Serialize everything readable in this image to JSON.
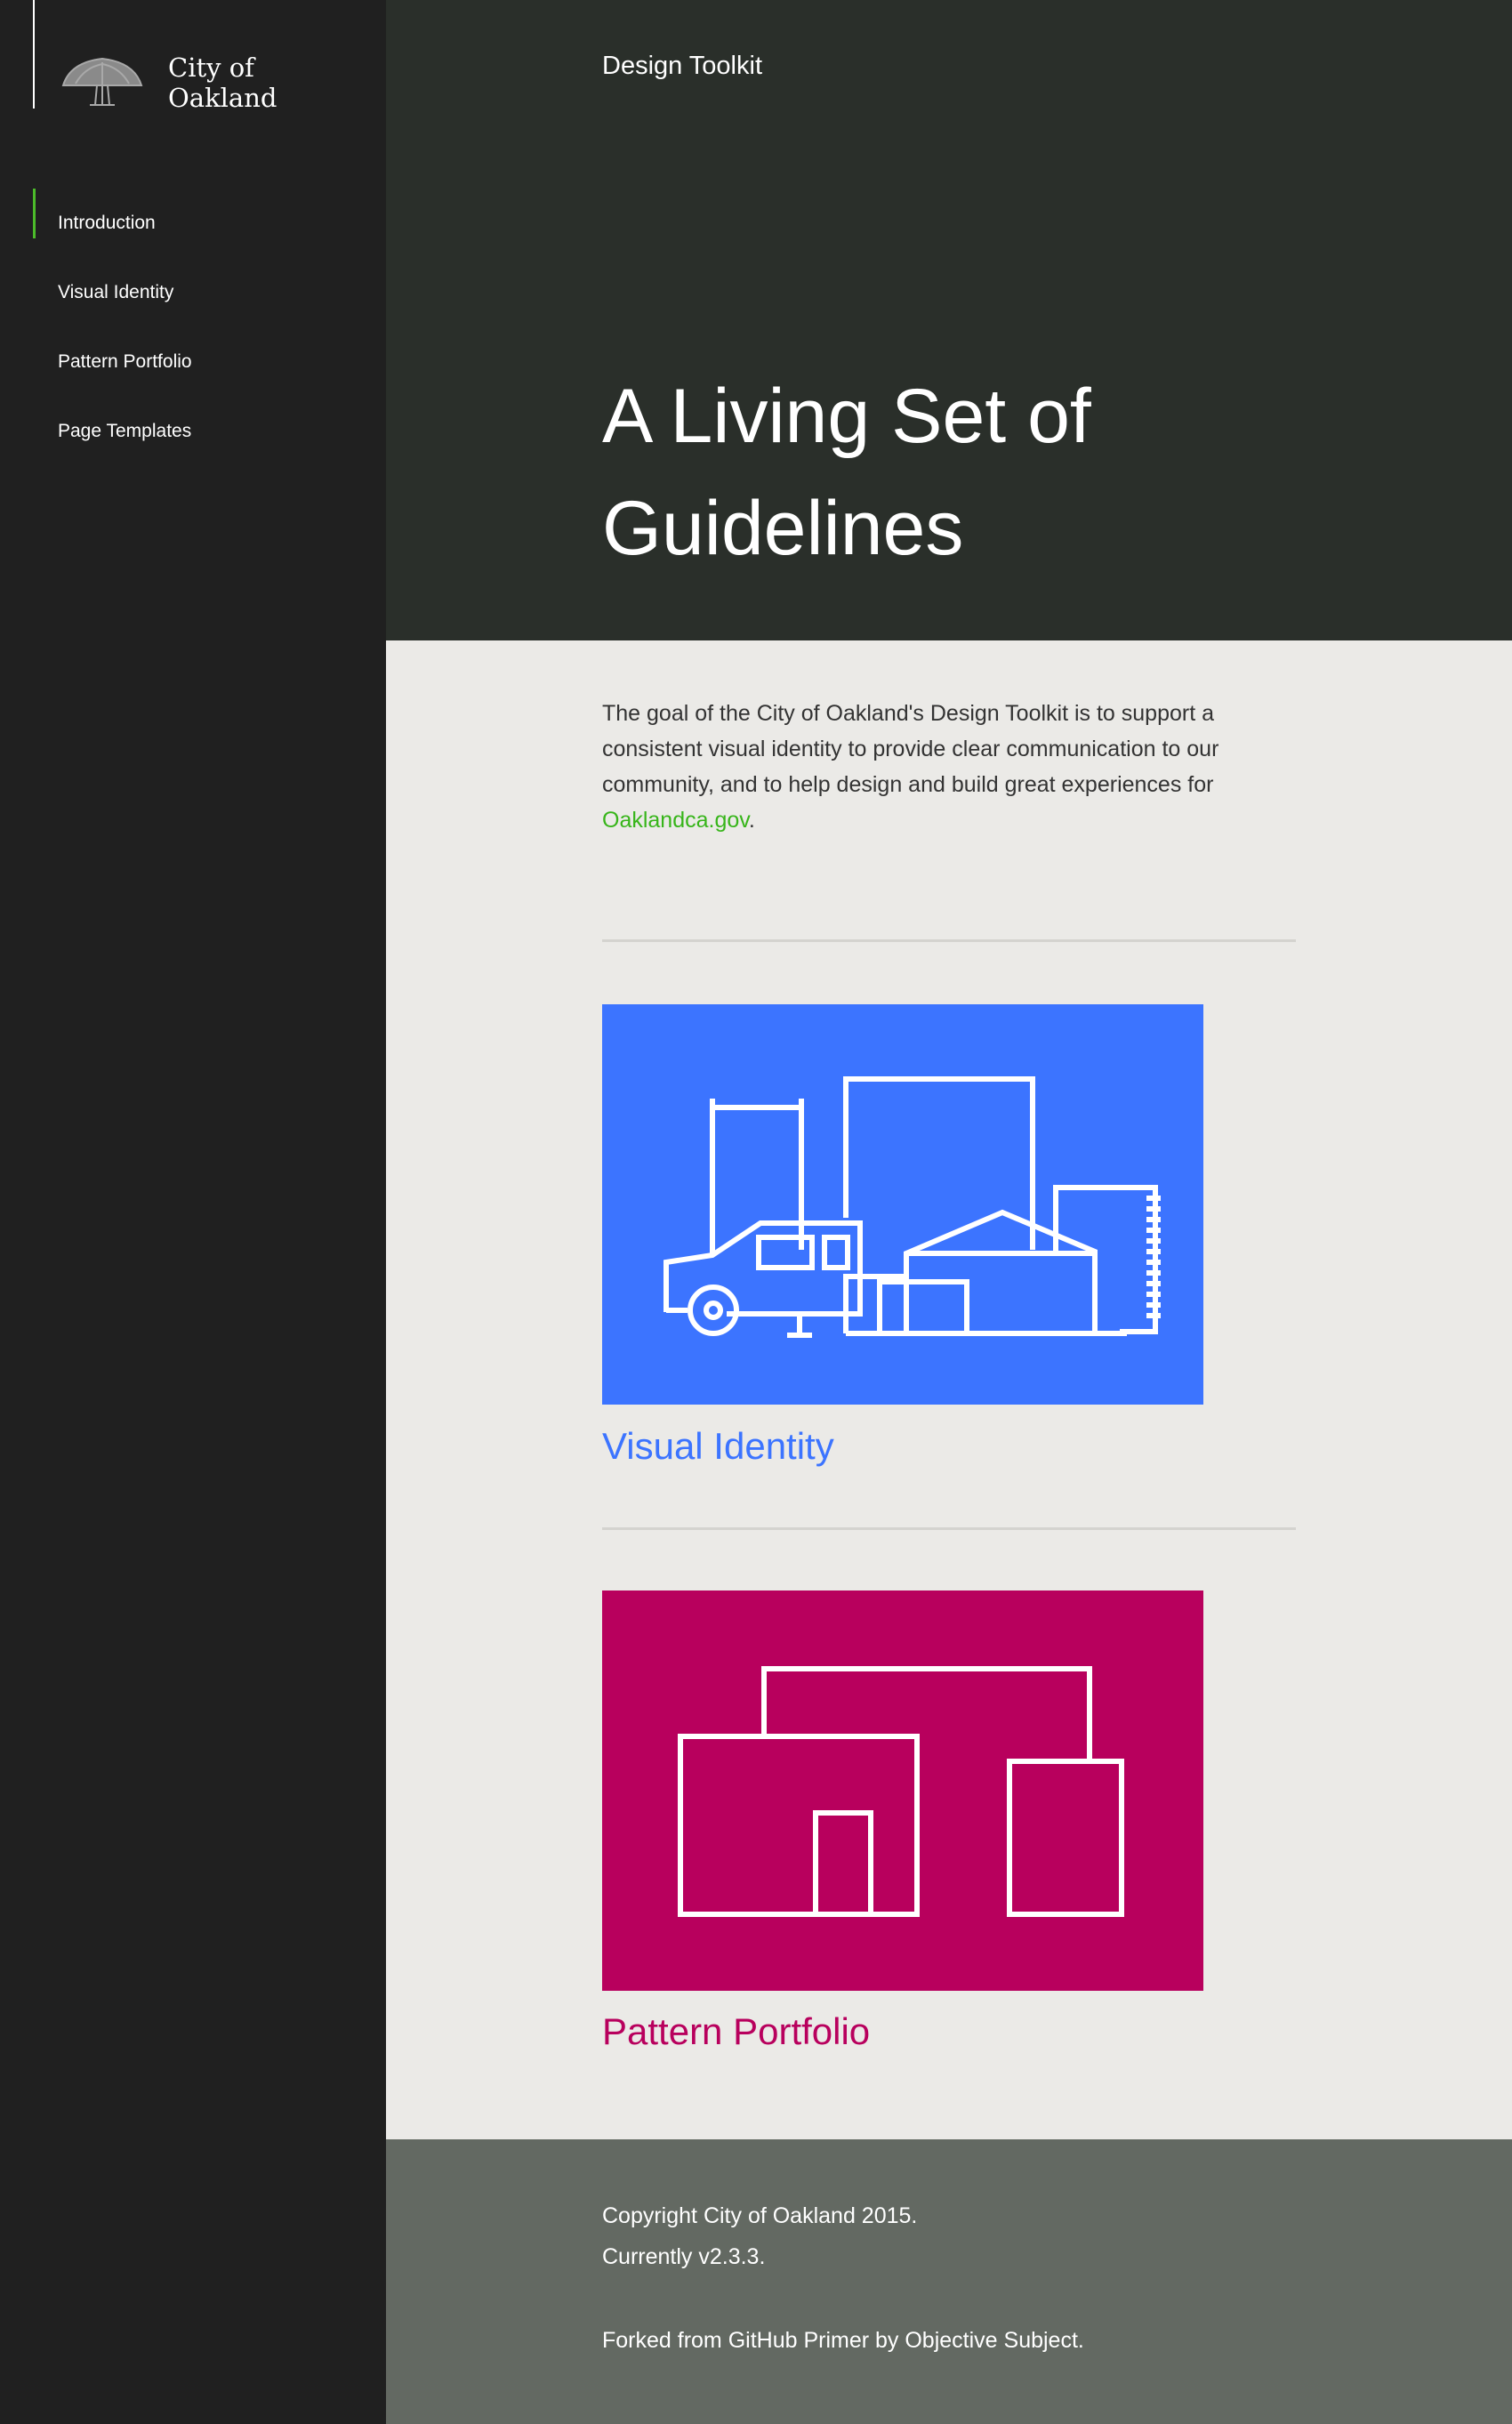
{
  "sidebar": {
    "logo": {
      "line1": "City of",
      "line2": "Oakland",
      "icon": "oak-tree-icon"
    },
    "nav": [
      {
        "label": "Introduction",
        "active": true
      },
      {
        "label": "Visual Identity"
      },
      {
        "label": "Pattern Portfolio"
      },
      {
        "label": "Page Templates"
      }
    ]
  },
  "header": {
    "brand": "Design Toolkit",
    "title": "A Living Set of Guidelines"
  },
  "intro": {
    "text": "The goal of the City of Oakland's Design Toolkit is to support a consistent visual identity to provide clear communication to our community, and to help design and build great experiences for ",
    "link": "Oaklandca.gov",
    "end": "."
  },
  "cards": [
    {
      "title": "Visual Identity",
      "color": "#3c74ff",
      "icon": "city-truck-illustration"
    },
    {
      "title": "Pattern Portfolio",
      "color": "#b8005d",
      "icon": "buildings-illustration"
    }
  ],
  "footer": {
    "copyright": "Copyright City of Oakland 2015.",
    "version": "Currently v2.3.3.",
    "forked": "Forked from GitHub Primer by Objective Subject."
  },
  "colors": {
    "sidebar_bg": "#202020",
    "hero_bg": "#2a2f2a",
    "accent_green": "#4cbc2a",
    "link_green": "#37b51a",
    "footer_bg": "#636962"
  }
}
